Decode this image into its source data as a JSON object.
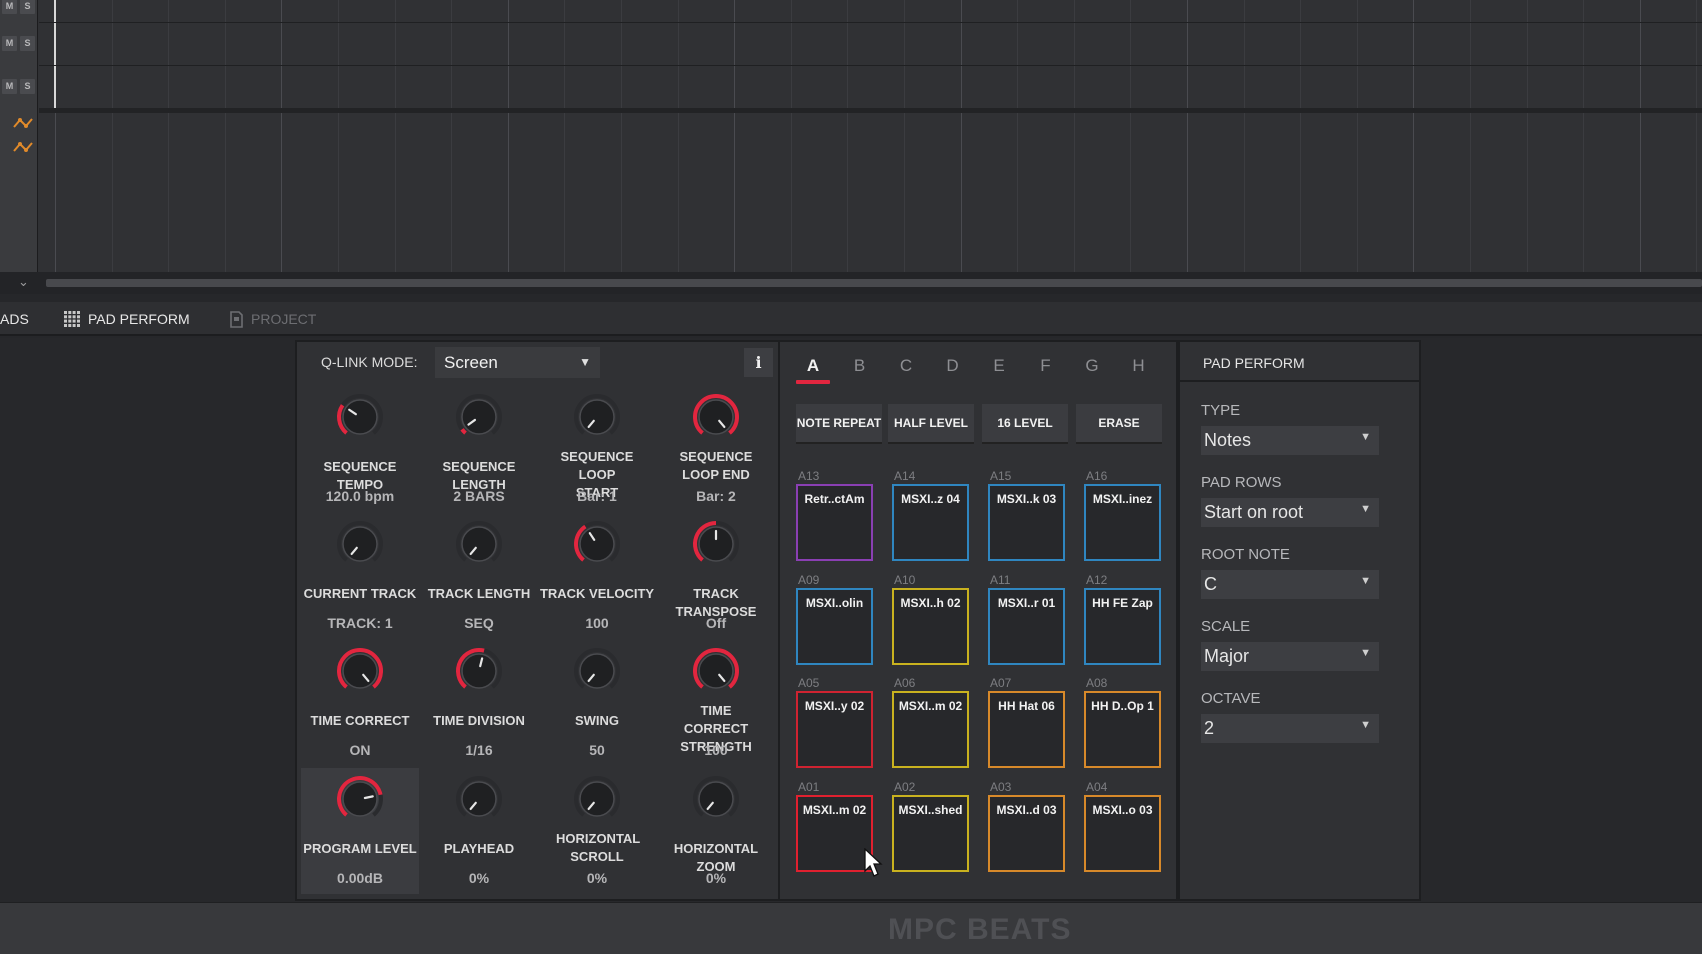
{
  "sequencer": {
    "tracks": [
      {
        "mute": "M",
        "solo": "S"
      },
      {
        "mute": "M",
        "solo": "S"
      },
      {
        "mute": "M",
        "solo": "S"
      }
    ],
    "automation_icon": "automation-curve-icon",
    "scroll_icon": "chevron-down-icon"
  },
  "tabs": {
    "pads_label": "ADS",
    "pad_perform_label": "PAD PERFORM",
    "project_label": "PROJECT"
  },
  "qlink": {
    "mode_label": "Q-LINK MODE:",
    "mode_value": "Screen",
    "info_label": "i",
    "knobs": [
      {
        "label": "SEQUENCE TEMPO",
        "value": "120.0 bpm",
        "level": 0.3
      },
      {
        "label": "SEQUENCE LENGTH",
        "value": "2 BARS",
        "level": 0.05
      },
      {
        "label": "SEQUENCE LOOP START",
        "value": "Bar: 1",
        "level": 0.0
      },
      {
        "label": "SEQUENCE LOOP END",
        "value": "Bar: 2",
        "level": 1.0
      },
      {
        "label": "CURRENT TRACK",
        "value": "TRACK: 1",
        "level": 0.0
      },
      {
        "label": "TRACK LENGTH",
        "value": "SEQ",
        "level": 0.0
      },
      {
        "label": "TRACK VELOCITY",
        "value": "100",
        "level": 0.38
      },
      {
        "label": "TRACK TRANSPOSE",
        "value": "Off",
        "level": 0.5
      },
      {
        "label": "TIME CORRECT",
        "value": "ON",
        "level": 1.0
      },
      {
        "label": "TIME DIVISION",
        "value": "1/16",
        "level": 0.55
      },
      {
        "label": "SWING",
        "value": "50",
        "level": 0.0
      },
      {
        "label": "TIME CORRECT STRENGTH",
        "value": "100",
        "level": 1.0
      },
      {
        "label": "PROGRAM LEVEL",
        "value": "0.00dB",
        "level": 0.78
      },
      {
        "label": "PLAYHEAD",
        "value": "0%",
        "level": 0.0
      },
      {
        "label": "HORIZONTAL SCROLL",
        "value": "0%",
        "level": 0.0
      },
      {
        "label": "HORIZONTAL ZOOM",
        "value": "0%",
        "level": 0.0
      }
    ]
  },
  "pads": {
    "banks": [
      "A",
      "B",
      "C",
      "D",
      "E",
      "F",
      "G",
      "H"
    ],
    "active_bank": "A",
    "buttons": [
      "NOTE REPEAT",
      "HALF LEVEL",
      "16 LEVEL",
      "ERASE"
    ],
    "rows": [
      [
        {
          "id": "A13",
          "name": "Retr..ctAm",
          "color": "#8a3fb3"
        },
        {
          "id": "A14",
          "name": "MSXI..z 04",
          "color": "#2f86c0"
        },
        {
          "id": "A15",
          "name": "MSXI..k 03",
          "color": "#2f86c0"
        },
        {
          "id": "A16",
          "name": "MSXI..inez",
          "color": "#2f86c0"
        }
      ],
      [
        {
          "id": "A09",
          "name": "MSXI..olin",
          "color": "#2f86c0"
        },
        {
          "id": "A10",
          "name": "MSXI..h 02",
          "color": "#c9b21f"
        },
        {
          "id": "A11",
          "name": "MSXI..r 01",
          "color": "#2f86c0"
        },
        {
          "id": "A12",
          "name": "HH FE Zap",
          "color": "#2f86c0"
        }
      ],
      [
        {
          "id": "A05",
          "name": "MSXI..y 02",
          "color": "#cf2331"
        },
        {
          "id": "A06",
          "name": "MSXI..m 02",
          "color": "#c9b21f"
        },
        {
          "id": "A07",
          "name": "HH Hat 06",
          "color": "#d7892a"
        },
        {
          "id": "A08",
          "name": "HH D..Op 1",
          "color": "#d7892a"
        }
      ],
      [
        {
          "id": "A01",
          "name": "MSXI..m 02",
          "color": "#e0202f"
        },
        {
          "id": "A02",
          "name": "MSXI..shed",
          "color": "#c9b21f"
        },
        {
          "id": "A03",
          "name": "MSXI..d 03",
          "color": "#d7892a"
        },
        {
          "id": "A04",
          "name": "MSXI..o 03",
          "color": "#d7892a"
        }
      ]
    ]
  },
  "pad_perform": {
    "title": "PAD PERFORM",
    "fields": [
      {
        "label": "TYPE",
        "value": "Notes"
      },
      {
        "label": "PAD ROWS",
        "value": "Start on root"
      },
      {
        "label": "ROOT NOTE",
        "value": "C"
      },
      {
        "label": "SCALE",
        "value": "Major"
      },
      {
        "label": "OCTAVE",
        "value": "2"
      }
    ]
  },
  "footer": {
    "logo": "MPC BEATS"
  },
  "colors": {
    "accent": "#e2263f",
    "knob_track": "#2a2b2e"
  }
}
